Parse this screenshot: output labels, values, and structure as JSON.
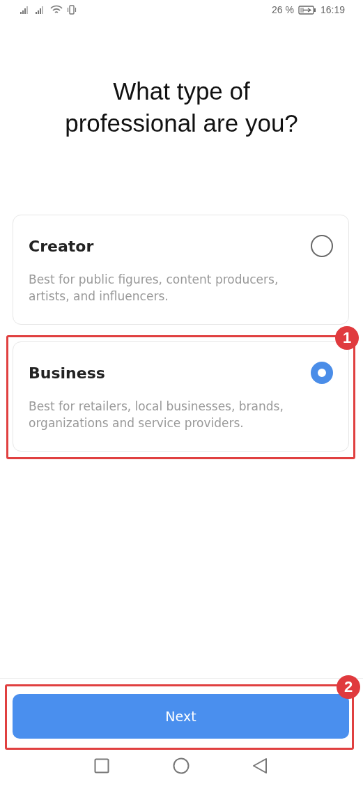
{
  "status_bar": {
    "battery_percent": "26 %",
    "time": "16:19"
  },
  "title": "What type of professional are you?",
  "options": [
    {
      "title": "Creator",
      "description": "Best for public figures, content producers, artists, and influencers.",
      "selected": false
    },
    {
      "title": "Business",
      "description": "Best for retailers, local businesses, brands, organizations and service providers.",
      "selected": true,
      "annotation": "1"
    }
  ],
  "next_button": {
    "label": "Next",
    "annotation": "2"
  }
}
